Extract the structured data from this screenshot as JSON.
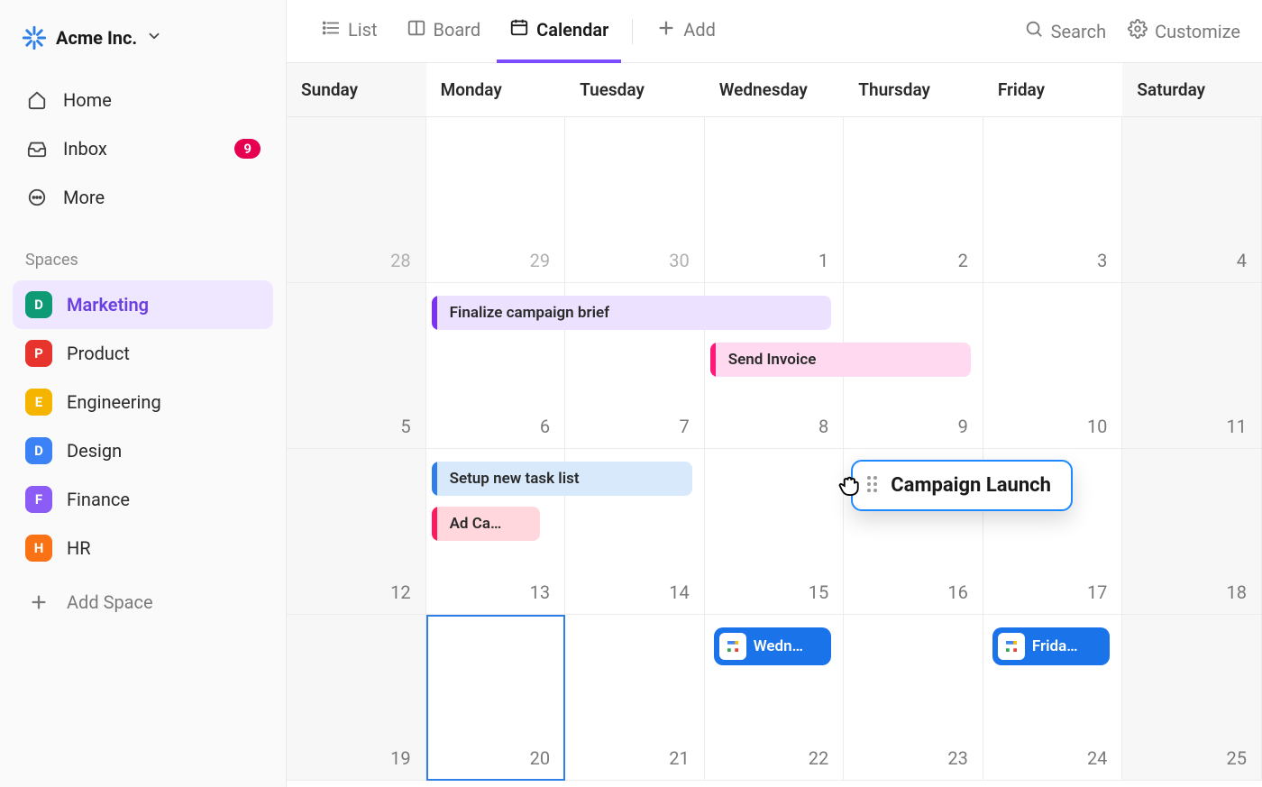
{
  "workspace": {
    "name": "Acme Inc."
  },
  "nav": {
    "home": "Home",
    "inbox": "Inbox",
    "inbox_badge": "9",
    "more": "More"
  },
  "spaces_header": "Spaces",
  "spaces": [
    {
      "letter": "D",
      "label": "Marketing",
      "color": "#0f9a76",
      "active": true
    },
    {
      "letter": "P",
      "label": "Product",
      "color": "#e7352d"
    },
    {
      "letter": "E",
      "label": "Engineering",
      "color": "#f4b400"
    },
    {
      "letter": "D",
      "label": "Design",
      "color": "#3b82f6"
    },
    {
      "letter": "F",
      "label": "Finance",
      "color": "#8b5cf6"
    },
    {
      "letter": "H",
      "label": "HR",
      "color": "#f97316"
    }
  ],
  "add_space": "Add Space",
  "views": {
    "list": "List",
    "board": "Board",
    "calendar": "Calendar",
    "add": "Add"
  },
  "top_right": {
    "search": "Search",
    "customize": "Customize"
  },
  "calendar": {
    "days": [
      "Sunday",
      "Monday",
      "Tuesday",
      "Wednesday",
      "Thursday",
      "Friday",
      "Saturday"
    ],
    "weeks": [
      [
        {
          "n": "28",
          "dim": true
        },
        {
          "n": "29",
          "dim": true
        },
        {
          "n": "30",
          "dim": true
        },
        {
          "n": "1"
        },
        {
          "n": "2"
        },
        {
          "n": "3"
        },
        {
          "n": "4"
        }
      ],
      [
        {
          "n": "5"
        },
        {
          "n": "6"
        },
        {
          "n": "7"
        },
        {
          "n": "8"
        },
        {
          "n": "9"
        },
        {
          "n": "10"
        },
        {
          "n": "11"
        }
      ],
      [
        {
          "n": "12"
        },
        {
          "n": "13"
        },
        {
          "n": "14"
        },
        {
          "n": "15"
        },
        {
          "n": "16"
        },
        {
          "n": "17"
        },
        {
          "n": "18"
        }
      ],
      [
        {
          "n": "19"
        },
        {
          "n": "20",
          "today": true
        },
        {
          "n": "21"
        },
        {
          "n": "22"
        },
        {
          "n": "23"
        },
        {
          "n": "24"
        },
        {
          "n": "25"
        }
      ]
    ]
  },
  "events": {
    "finalize": {
      "title": "Finalize campaign brief",
      "bg": "#ece1ff",
      "stripe": "#7b2ff7"
    },
    "invoice": {
      "title": "Send Invoice",
      "bg": "#ffd9ef",
      "stripe": "#ff1a79"
    },
    "setup": {
      "title": "Setup new task list",
      "bg": "#d8e9fb",
      "stripe": "#2f7fe8"
    },
    "adca": {
      "title": "Ad Ca…",
      "bg": "#ffd7dc",
      "stripe": "#ff1a5d"
    },
    "drag": {
      "title": "Campaign Launch"
    },
    "gcal_wed": {
      "title": "Wedn…"
    },
    "gcal_fri": {
      "title": "Frida…"
    }
  }
}
